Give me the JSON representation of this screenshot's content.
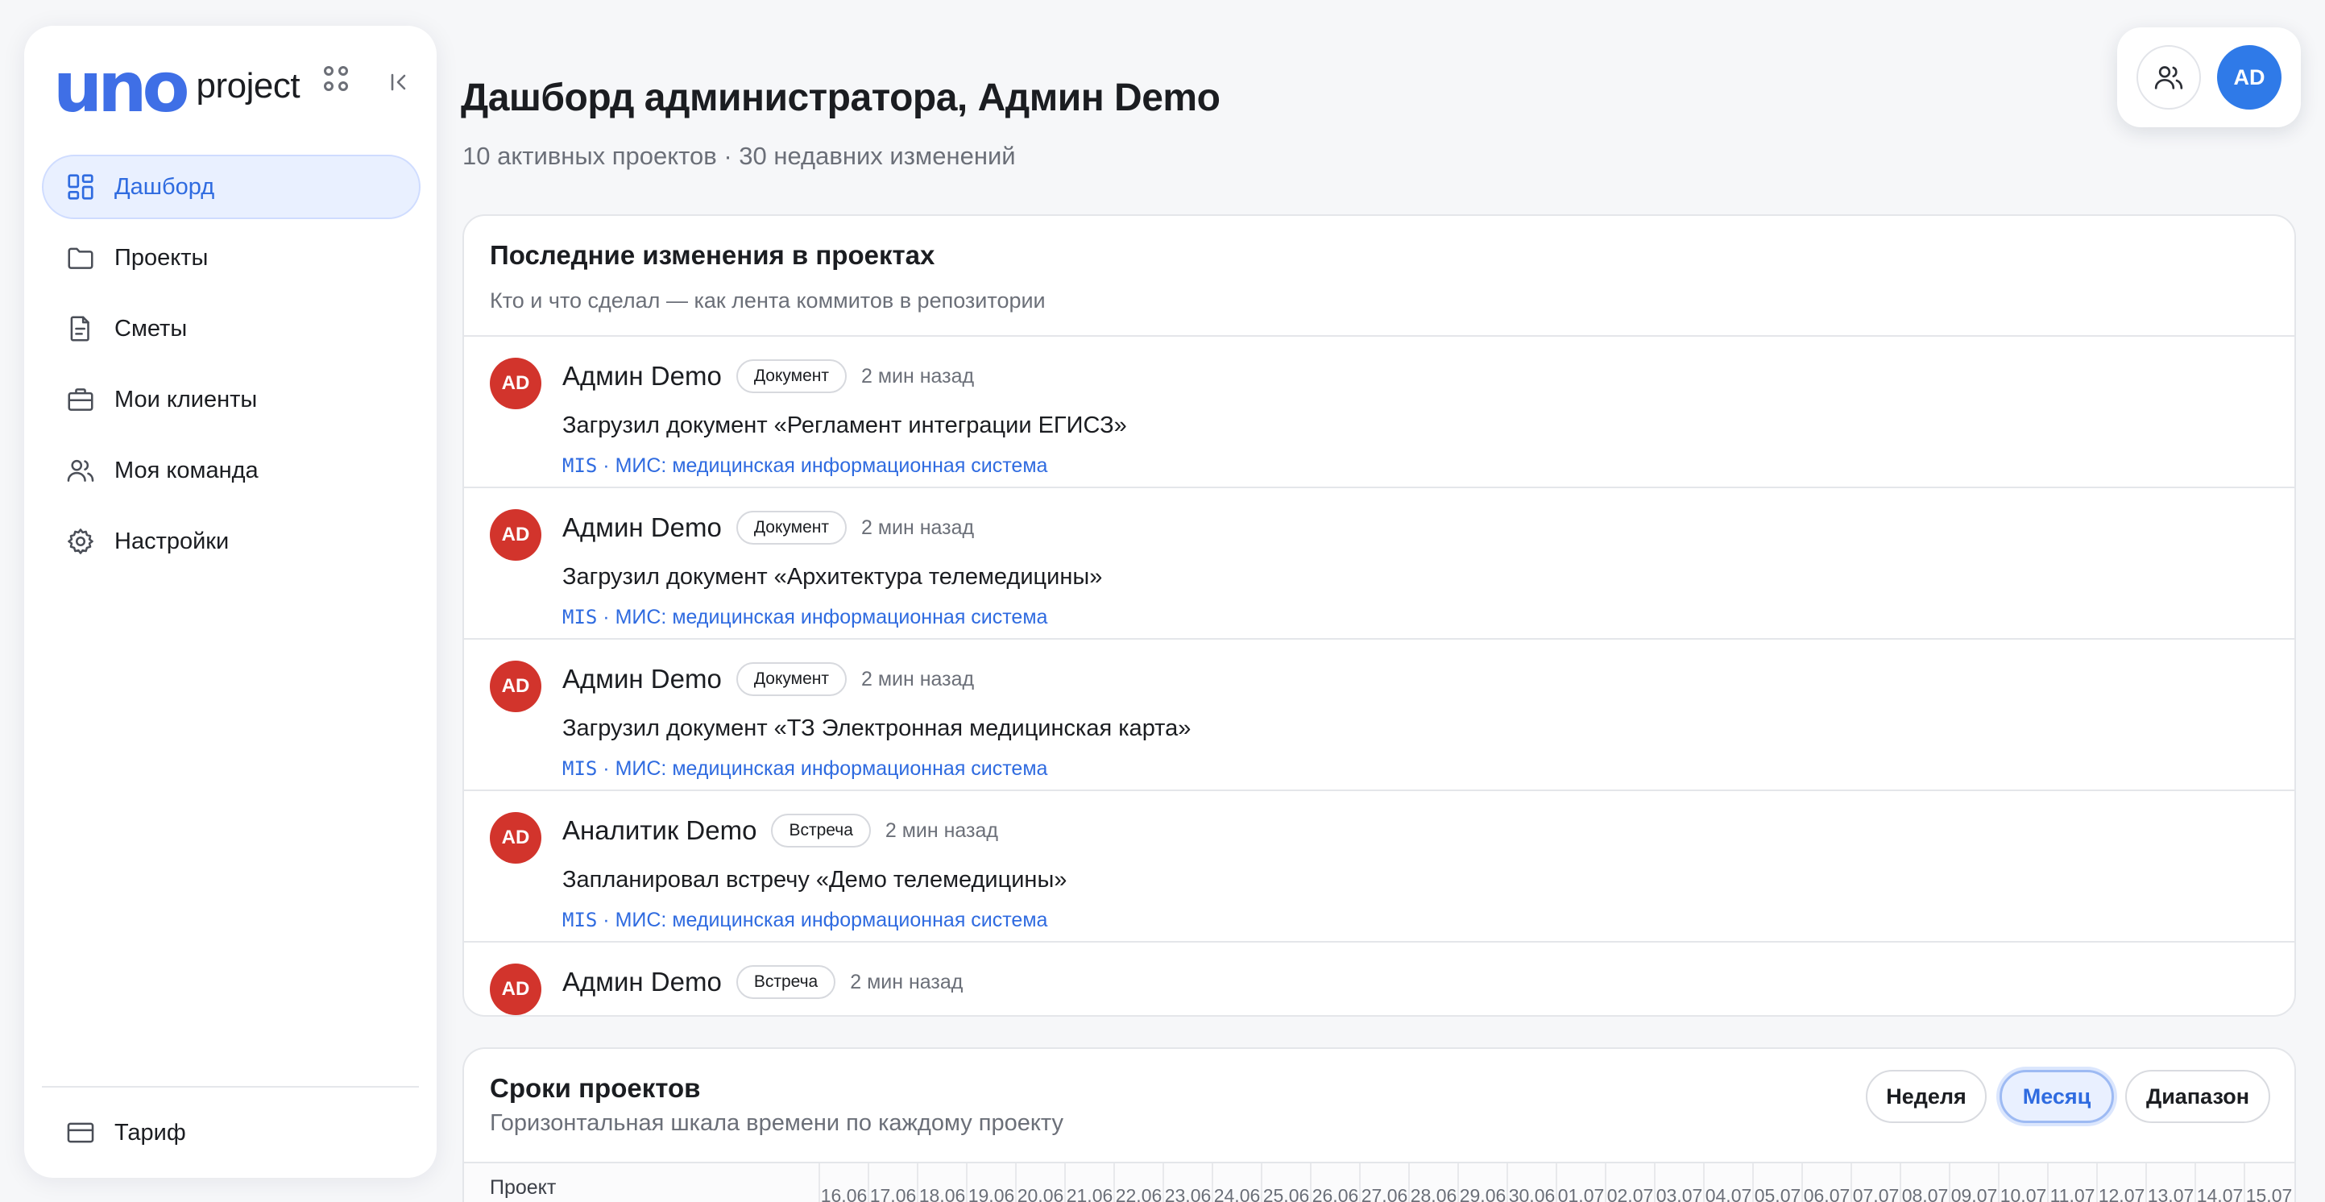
{
  "app": {
    "logo_mark": "uno",
    "logo_text": "project"
  },
  "sidebar": {
    "items": [
      {
        "label": "Дашборд",
        "icon": "dashboard-icon",
        "active": true
      },
      {
        "label": "Проекты",
        "icon": "folder-icon",
        "active": false
      },
      {
        "label": "Сметы",
        "icon": "document-icon",
        "active": false
      },
      {
        "label": "Мои клиенты",
        "icon": "briefcase-icon",
        "active": false
      },
      {
        "label": "Моя команда",
        "icon": "users-icon",
        "active": false
      },
      {
        "label": "Настройки",
        "icon": "gear-icon",
        "active": false
      }
    ],
    "footer_label": "Тариф"
  },
  "user": {
    "initials": "AD"
  },
  "header": {
    "title": "Дашборд администратора, Админ Demo",
    "subtitle": "10 активных проектов · 30 недавних изменений"
  },
  "changes": {
    "title": "Последние изменения в проектах",
    "subtitle": "Кто и что сделал — как лента коммитов в репозитории",
    "items": [
      {
        "initials": "AD",
        "author": "Админ Demo",
        "badge": "Документ",
        "time": "2 мин назад",
        "action": "Загрузил документ «Регламент интеграции ЕГИСЗ»",
        "project_code": "MIS",
        "project_sep": " · ",
        "project_name": "МИС: медицинская информационная система"
      },
      {
        "initials": "AD",
        "author": "Админ Demo",
        "badge": "Документ",
        "time": "2 мин назад",
        "action": "Загрузил документ «Архитектура телемедицины»",
        "project_code": "MIS",
        "project_sep": " · ",
        "project_name": "МИС: медицинская информационная система"
      },
      {
        "initials": "AD",
        "author": "Админ Demo",
        "badge": "Документ",
        "time": "2 мин назад",
        "action": "Загрузил документ «ТЗ Электронная медицинская карта»",
        "project_code": "MIS",
        "project_sep": " · ",
        "project_name": "МИС: медицинская информационная система"
      },
      {
        "initials": "AD",
        "author": "Аналитик Demo",
        "badge": "Встреча",
        "time": "2 мин назад",
        "action": "Запланировал встречу «Демо телемедицины»",
        "project_code": "MIS",
        "project_sep": " · ",
        "project_name": "МИС: медицинская информационная система"
      },
      {
        "initials": "AD",
        "author": "Админ Demo",
        "badge": "Встреча",
        "time": "2 мин назад",
        "action": "",
        "project_code": "",
        "project_sep": "",
        "project_name": ""
      }
    ]
  },
  "timeline": {
    "title": "Сроки проектов",
    "subtitle": "Горизонтальная шкала времени по каждому проекту",
    "modes": [
      {
        "label": "Неделя",
        "active": false
      },
      {
        "label": "Месяц",
        "active": true
      },
      {
        "label": "Диапазон",
        "active": false
      }
    ],
    "project_column": "Проект",
    "dates": [
      "16.06",
      "17.06",
      "18.06",
      "19.06",
      "20.06",
      "21.06",
      "22.06",
      "23.06",
      "24.06",
      "25.06",
      "26.06",
      "27.06",
      "28.06",
      "29.06",
      "30.06",
      "01.07",
      "02.07",
      "03.07",
      "04.07",
      "05.07",
      "06.07",
      "07.07",
      "08.07",
      "09.07",
      "10.07",
      "11.07",
      "12.07",
      "13.07",
      "14.07",
      "15.07"
    ]
  },
  "colors": {
    "accent": "#2f6be0",
    "avatar_red": "#d2342c",
    "avatar_blue": "#2f7ae8"
  }
}
